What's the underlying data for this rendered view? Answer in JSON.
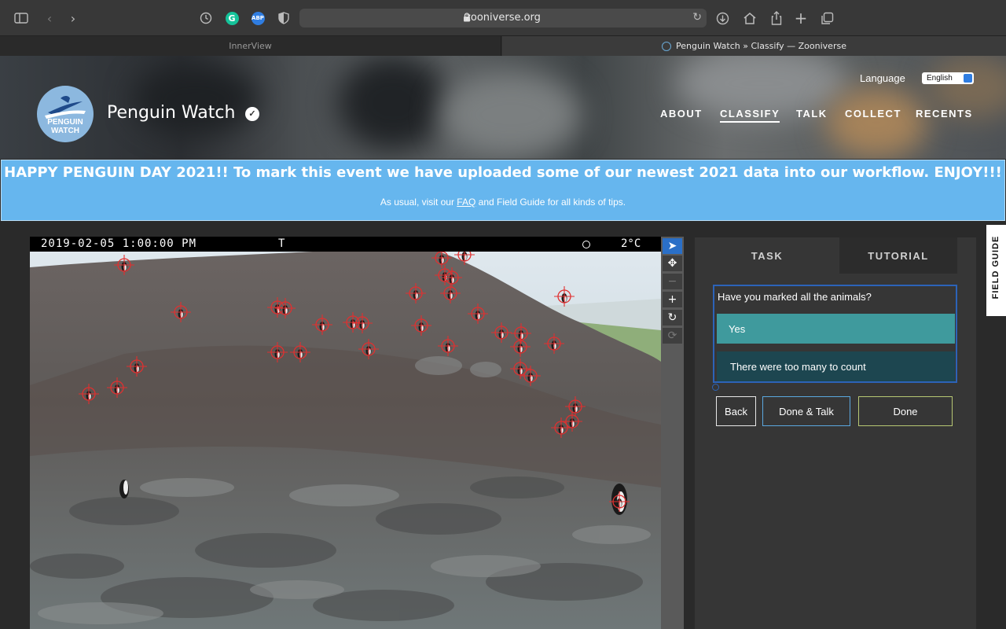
{
  "browser": {
    "url": "zooniverse.org",
    "tabs": [
      {
        "title": "InnerView",
        "active": false
      },
      {
        "title": "Penguin Watch » Classify — Zooniverse",
        "active": true
      }
    ],
    "icons": [
      "sidebar-icon",
      "back-icon",
      "forward-icon",
      "clock-icon",
      "grammarly-icon",
      "adblock-icon",
      "shield-icon",
      "reload-icon",
      "download-icon",
      "home-icon",
      "share-icon",
      "new-tab-icon",
      "tabs-icon"
    ],
    "extension_labels": {
      "grammarly": "G",
      "adblock": "ABP"
    }
  },
  "header": {
    "logo_text": [
      "PENGUIN",
      "WATCH"
    ],
    "project_title": "Penguin Watch",
    "language_label": "Language",
    "language_value": "English",
    "nav": [
      {
        "label": "ABOUT",
        "active": false
      },
      {
        "label": "CLASSIFY",
        "active": true
      },
      {
        "label": "TALK",
        "active": false
      },
      {
        "label": "COLLECT",
        "active": false
      },
      {
        "label": "RECENTS",
        "active": false
      }
    ]
  },
  "announcement": {
    "headline": "HAPPY PENGUIN DAY 2021!! To mark this event we have uploaded some of our newest 2021 data into our workflow. ENJOY!!!",
    "sub_before": "As usual, visit our ",
    "sub_link": "FAQ",
    "sub_after": " and Field Guide for all kinds of tips."
  },
  "subject": {
    "timestamp": "2019-02-05 1:00:00 PM",
    "camera_letter": "T",
    "temperature": "2°C"
  },
  "tools": [
    {
      "name": "pointer-tool",
      "glyph": "➤",
      "active": true
    },
    {
      "name": "pan-tool",
      "glyph": "✥",
      "active": false
    },
    {
      "name": "zoom-out-tool",
      "glyph": "−",
      "active": false
    },
    {
      "name": "zoom-in-tool",
      "glyph": "+",
      "active": false
    },
    {
      "name": "rotate-tool",
      "glyph": "↻",
      "active": false
    },
    {
      "name": "reset-tool",
      "glyph": "⟳",
      "active": false
    }
  ],
  "task_panel": {
    "tabs": [
      "TASK",
      "TUTORIAL"
    ],
    "question": "Have you marked all the animals?",
    "answers": [
      "Yes",
      "There were too many to count"
    ],
    "buttons": {
      "back": "Back",
      "done_talk": "Done & Talk",
      "done": "Done"
    }
  },
  "field_guide_label": "FIELD GUIDE",
  "colors": {
    "announcement_bg": "#66b6ee",
    "answer_yes": "#3f9a9d",
    "answer_many": "#1d4650",
    "marker_red": "#e03030",
    "done_border": "#b7c773",
    "done_talk_border": "#5ba8e0"
  }
}
